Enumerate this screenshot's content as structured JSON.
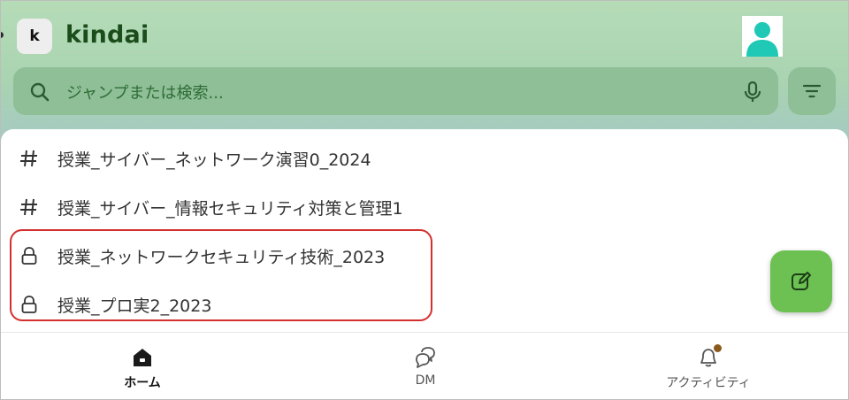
{
  "workspace": {
    "badge": "k",
    "name": "kindai"
  },
  "search": {
    "placeholder": "ジャンプまたは検索..."
  },
  "channels": [
    {
      "icon": "hash-icon",
      "label": "授業_サイバー_ネットワーク演習0_2024"
    },
    {
      "icon": "hash-icon",
      "label": "授業_サイバー_情報セキュリティ対策と管理1"
    },
    {
      "icon": "lock-icon",
      "label": "授業_ネットワークセキュリティ技術_2023"
    },
    {
      "icon": "lock-icon",
      "label": "授業_プロ実2_2023"
    }
  ],
  "bottom_nav": {
    "home": "ホーム",
    "dm": "DM",
    "activity": "アクティビティ"
  },
  "colors": {
    "header_green": "#b5dcb7",
    "search_bg": "#8fbf97",
    "fab_green": "#6cc152",
    "highlight_red": "#d32f2f",
    "avatar_teal": "#1fc9b5"
  }
}
